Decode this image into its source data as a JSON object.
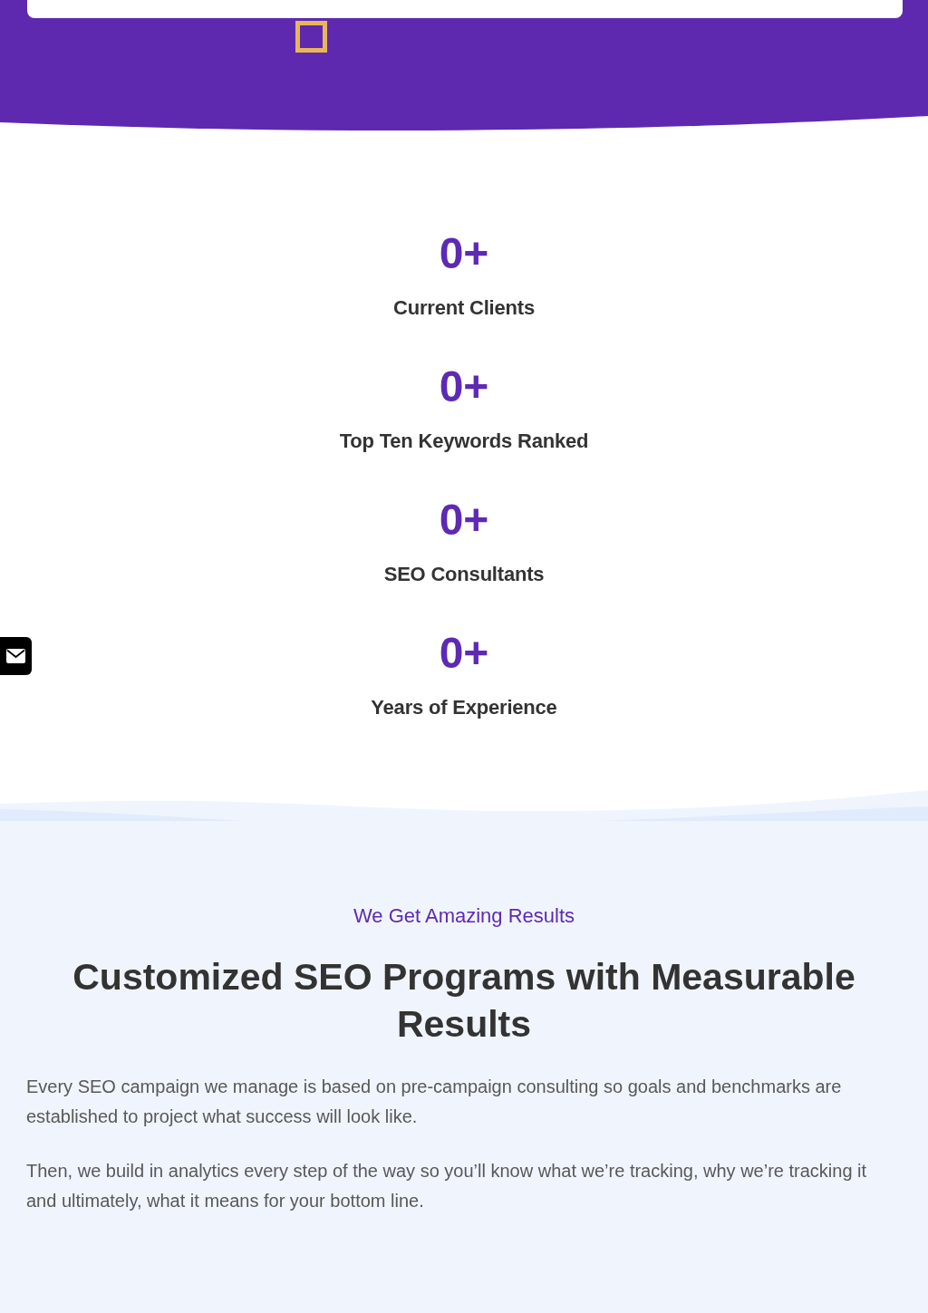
{
  "stats": [
    {
      "value": "0+",
      "label": "Current Clients"
    },
    {
      "value": "0+",
      "label": "Top Ten Keywords Ranked"
    },
    {
      "value": "0+",
      "label": "SEO Consultants"
    },
    {
      "value": "0+",
      "label": "Years of Experience"
    }
  ],
  "results": {
    "eyebrow": "We Get Amazing Results",
    "heading": "Customized SEO Programs with Measurable Results",
    "paragraphs": [
      "Every SEO campaign we manage is based on pre-campaign consulting so goals and benchmarks are established to project what success will look like.",
      "Then, we build in analytics every step of the way so you’ll know what we’re tracking, why we’re tracking it and ultimately, what it means for your bottom line."
    ]
  }
}
